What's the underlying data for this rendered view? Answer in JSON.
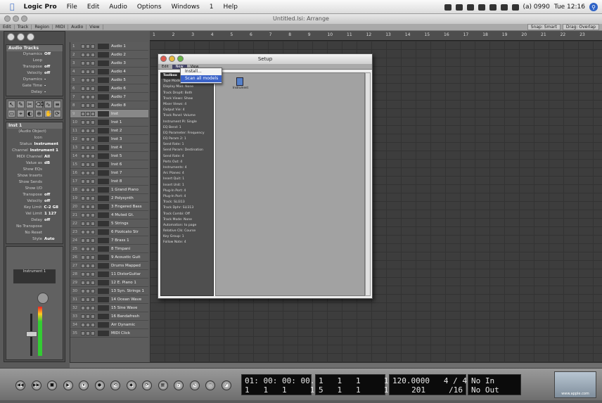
{
  "menubar": {
    "app": "Logic Pro",
    "items": [
      "File",
      "Edit",
      "Audio",
      "Options",
      "Windows",
      "1",
      "Help"
    ],
    "status": "(a) 0990",
    "clock": "Tue 12:16"
  },
  "window": {
    "title": "Untitled.lsi: Arrange",
    "local_menus": [
      "Edit",
      "Track",
      "Region",
      "MIDI",
      "Audio",
      "View"
    ],
    "snap": "Snap: Smart",
    "drag": "Drag: Overlap"
  },
  "ruler": [
    "1",
    "2",
    "3",
    "4",
    "5",
    "6",
    "7",
    "8",
    "9",
    "10",
    "11",
    "12",
    "13",
    "14",
    "15",
    "16",
    "17",
    "18",
    "19",
    "20",
    "21",
    "22",
    "23"
  ],
  "inspector": {
    "region_head": "Audio Tracks",
    "region_rows": [
      {
        "k": "Dynamics",
        "v": "Off"
      },
      {
        "k": "Loop",
        "v": ""
      },
      {
        "k": "Transpose",
        "v": "off"
      },
      {
        "k": "Velocity",
        "v": "off"
      },
      {
        "k": "Dynamics",
        "v": "-"
      },
      {
        "k": "Gate Time",
        "v": "-"
      },
      {
        "k": "Delay",
        "v": "-"
      }
    ],
    "track_head": "Inst 1",
    "track_sub": "(Audio Object)",
    "track_rows": [
      {
        "k": "Icon",
        "v": ""
      },
      {
        "k": "Status",
        "v": "Instrument"
      },
      {
        "k": "Channel",
        "v": "Instrument 1"
      },
      {
        "k": "MIDI Channel",
        "v": "All"
      },
      {
        "k": "Value as",
        "v": "dB"
      },
      {
        "k": "Show EQs",
        "v": ""
      },
      {
        "k": "Show Inserts",
        "v": ""
      },
      {
        "k": "Show Sends",
        "v": ""
      },
      {
        "k": "Show I/O",
        "v": ""
      },
      {
        "k": "Transpose",
        "v": "off"
      },
      {
        "k": "Velocity",
        "v": "off"
      },
      {
        "k": "Key Limit",
        "v": "C-2 G8"
      },
      {
        "k": "Vel Limit",
        "v": "1 127"
      },
      {
        "k": "Delay",
        "v": "off"
      },
      {
        "k": "No Transpose",
        "v": ""
      },
      {
        "k": "No Reset",
        "v": ""
      },
      {
        "k": "Style",
        "v": "Auto"
      }
    ],
    "channel_name": "Instrument 1",
    "tools": [
      "↖",
      "✎",
      "✂",
      "⌫",
      "∿",
      "≡",
      "▭",
      "⌖",
      "◐",
      "⊕",
      "✋",
      "⟳"
    ]
  },
  "tracks": [
    {
      "n": "1",
      "name": "Audio 1"
    },
    {
      "n": "2",
      "name": "Audio 2"
    },
    {
      "n": "3",
      "name": "Audio 3"
    },
    {
      "n": "4",
      "name": "Audio 4"
    },
    {
      "n": "5",
      "name": "Audio 5"
    },
    {
      "n": "6",
      "name": "Audio 6"
    },
    {
      "n": "7",
      "name": "Audio 7"
    },
    {
      "n": "8",
      "name": "Audio 8"
    },
    {
      "n": "9",
      "name": "Inst"
    },
    {
      "n": "10",
      "name": "Inst 1"
    },
    {
      "n": "11",
      "name": "Inst 2"
    },
    {
      "n": "12",
      "name": "Inst 3"
    },
    {
      "n": "13",
      "name": "Inst 4"
    },
    {
      "n": "14",
      "name": "Inst 5"
    },
    {
      "n": "15",
      "name": "Inst 6"
    },
    {
      "n": "16",
      "name": "Inst 7"
    },
    {
      "n": "17",
      "name": "Inst 8"
    },
    {
      "n": "18",
      "name": "1 Grand Piano"
    },
    {
      "n": "19",
      "name": "2 Polysynth"
    },
    {
      "n": "20",
      "name": "3 Fingered Bass"
    },
    {
      "n": "21",
      "name": "4 Muted Gt."
    },
    {
      "n": "22",
      "name": "5 Strings"
    },
    {
      "n": "23",
      "name": "6 Pizzicato Str"
    },
    {
      "n": "24",
      "name": "7 Brass 1"
    },
    {
      "n": "25",
      "name": "8 Timpani"
    },
    {
      "n": "26",
      "name": "9 Acoustic Guit"
    },
    {
      "n": "27",
      "name": "Drums Mapped"
    },
    {
      "n": "28",
      "name": "11 DistorGuitar"
    },
    {
      "n": "29",
      "name": "12 E. Piano 1"
    },
    {
      "n": "30",
      "name": "13 Syn. Strings 1"
    },
    {
      "n": "31",
      "name": "14 Ocean Wave"
    },
    {
      "n": "32",
      "name": "15 Sine Wave"
    },
    {
      "n": "33",
      "name": "16 Bandafresh"
    },
    {
      "n": "34",
      "name": "Arr Dynamic"
    },
    {
      "n": "35",
      "name": "MIDI Click"
    }
  ],
  "setup": {
    "title": "Setup",
    "menus": [
      "Edit",
      "New",
      "View"
    ],
    "new_menu": [
      "Install...",
      "Scan all models"
    ],
    "icon_label": "Instrument",
    "side": [
      {
        "label": "Toolbox",
        "head": true
      },
      {
        "label": "Tape Model: Off"
      },
      {
        "label": "Display Mod: None"
      },
      {
        "label": "Track Droplt: Both"
      },
      {
        "label": "Track Views: Show"
      },
      {
        "label": "Mixer Views: 4"
      },
      {
        "label": "Output Vie: 4"
      },
      {
        "label": "Track Panel: Volume"
      },
      {
        "label": "Instrument Pi: Single"
      },
      {
        "label": "EQ Bend: 1"
      },
      {
        "label": "EQ Parameter: Frequency"
      },
      {
        "label": "EQ Param 2: 1"
      },
      {
        "label": "Send Rate: 1"
      },
      {
        "label": "Send Param: Destination"
      },
      {
        "label": "Send Rate: 4"
      },
      {
        "label": "Ports Out: 4"
      },
      {
        "label": "Instruments: 4"
      },
      {
        "label": "Arc Planes: 4"
      },
      {
        "label": "Insert Quit: 1"
      },
      {
        "label": "Insert Unit: 1"
      },
      {
        "label": "Plug-In Port: 4"
      },
      {
        "label": "Plug-In Port: 4"
      },
      {
        "label": "Track: SLI313"
      },
      {
        "label": "Track Dphr: SLI313"
      },
      {
        "label": "Track Combi: Off"
      },
      {
        "label": "Track Mode: None"
      },
      {
        "label": "Automation: to page"
      },
      {
        "label": "Relative Clk: Course"
      },
      {
        "label": "Key Group: 1"
      },
      {
        "label": "Follow Note: 4"
      }
    ]
  },
  "transport": {
    "smpte": "01: 00: 00: 00.00",
    "smpte_sub": "1   1   1     1",
    "bars": "1   1   1     1",
    "bars_sub": "5   1   1     1",
    "tempo": "120.0000   4 / 4",
    "tempo_sub": "201     /16",
    "midi_in": "No In",
    "midi_out": "No Out",
    "logo": "www.apple.com",
    "buttons": [
      "◀◀",
      "▶▶",
      "■",
      "▶",
      "⏸",
      "●",
      "⟲",
      "◆",
      "⟳",
      "▦",
      "♪",
      "∿",
      "◎",
      "✓"
    ]
  }
}
